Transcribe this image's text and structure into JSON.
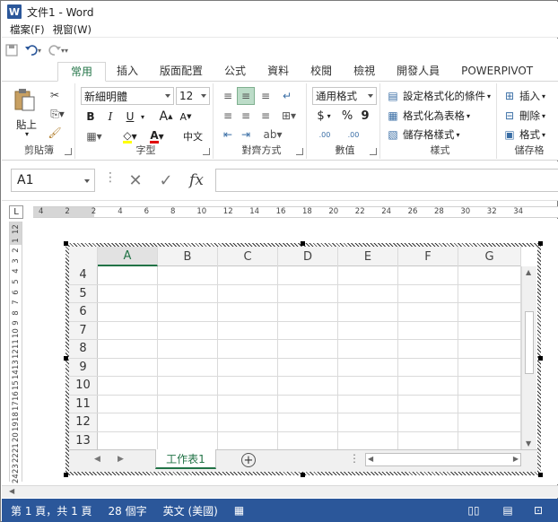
{
  "window": {
    "title": "文件1 - Word",
    "app_letter": "W"
  },
  "menu": [
    "檔案(F)",
    "視窗(W)"
  ],
  "qat": {
    "save": "save-icon",
    "undo": "undo-icon",
    "redo": "redo-icon",
    "customize": "▾"
  },
  "tabs": [
    "常用",
    "插入",
    "版面配置",
    "公式",
    "資料",
    "校閱",
    "檢視",
    "開發人員",
    "POWERPIVOT"
  ],
  "ribbon": {
    "clipboard": {
      "label": "剪貼簿",
      "paste": "貼上"
    },
    "font": {
      "label": "字型",
      "name": "新細明體",
      "size": "12",
      "bold": "B",
      "italic": "I",
      "underline": "U",
      "grow": "A",
      "shrink": "A",
      "phonetic": "中文"
    },
    "alignment": {
      "label": "對齊方式"
    },
    "number": {
      "label": "數值",
      "format": "通用格式",
      "currency": "$",
      "percent": "%",
      "comma": "9",
      "inc_decimal": ".00",
      "dec_decimal": ".00"
    },
    "styles": {
      "label": "樣式",
      "conditional": "設定格式化的條件",
      "as_table": "格式化為表格",
      "cell_styles": "儲存格樣式"
    },
    "cells": {
      "label": "儲存格",
      "insert": "插入",
      "delete": "刪除",
      "format": "格式"
    }
  },
  "formula_bar": {
    "name_box": "A1",
    "fx": "fx",
    "value": ""
  },
  "hruler_labels": [
    "4",
    "2",
    "2",
    "4",
    "6",
    "8",
    "10",
    "12",
    "14",
    "16",
    "18",
    "20",
    "22",
    "24",
    "26",
    "28",
    "30",
    "32",
    "34"
  ],
  "vruler_labels": [
    "12",
    "1",
    "2",
    "3",
    "4",
    "5",
    "6",
    "7",
    "8",
    "9",
    "10",
    "11",
    "12",
    "13",
    "14",
    "15",
    "16",
    "17",
    "18",
    "19",
    "20",
    "21",
    "22",
    "23",
    "24"
  ],
  "sheet": {
    "columns": [
      "A",
      "B",
      "C",
      "D",
      "E",
      "F",
      "G"
    ],
    "rows": [
      "4",
      "5",
      "6",
      "7",
      "8",
      "9",
      "10",
      "11",
      "12",
      "13"
    ],
    "tab_name": "工作表1",
    "add": "+"
  },
  "status": {
    "page": "第 1 頁，共 1 頁",
    "words": "28 個字",
    "language": "英文 (美國)"
  },
  "colors": {
    "word_blue": "#2b579a",
    "excel_green": "#217346"
  }
}
